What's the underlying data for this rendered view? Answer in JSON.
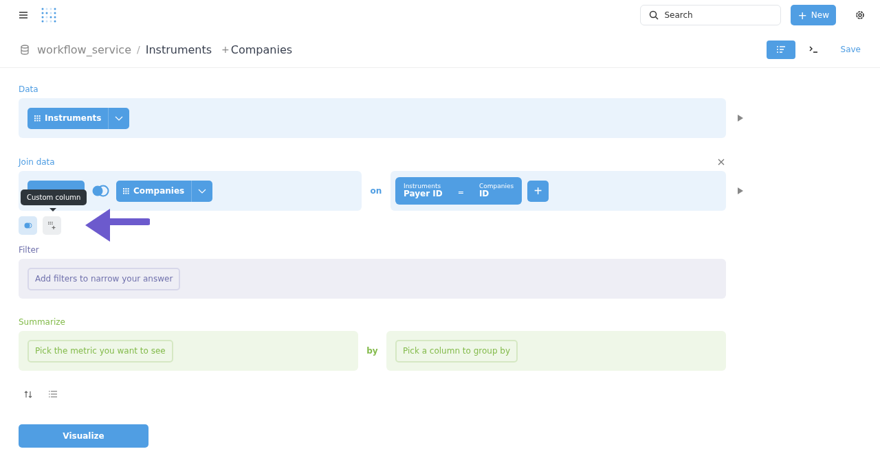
{
  "header": {
    "search": {
      "placeholder": "Search"
    },
    "new_button": {
      "icon": "+",
      "label": "New"
    }
  },
  "breadcrumb": {
    "database": "workflow_service",
    "separator": "/",
    "table": "Instruments",
    "join_mark": "+",
    "joined": "Companies"
  },
  "actions": {
    "notebook_selected": true,
    "save": "Save"
  },
  "data": {
    "label": "Data",
    "table": "Instruments"
  },
  "join": {
    "label": "Join data",
    "left_table_label_hidden": true,
    "right_table": "Companies",
    "on": "on",
    "condition": {
      "left_table": "Instruments",
      "left_column": "Payer ID",
      "operator": "=",
      "right_table": "Companies",
      "right_column": "ID"
    },
    "add": "+"
  },
  "tooltip": "Custom column",
  "filter": {
    "label": "Filter",
    "placeholder": "Add filters to narrow your answer"
  },
  "summarize": {
    "label": "Summarize",
    "metric": "Pick the metric you want to see",
    "by": "by",
    "group": "Pick a column to group by"
  },
  "visualize": "Visualize"
}
